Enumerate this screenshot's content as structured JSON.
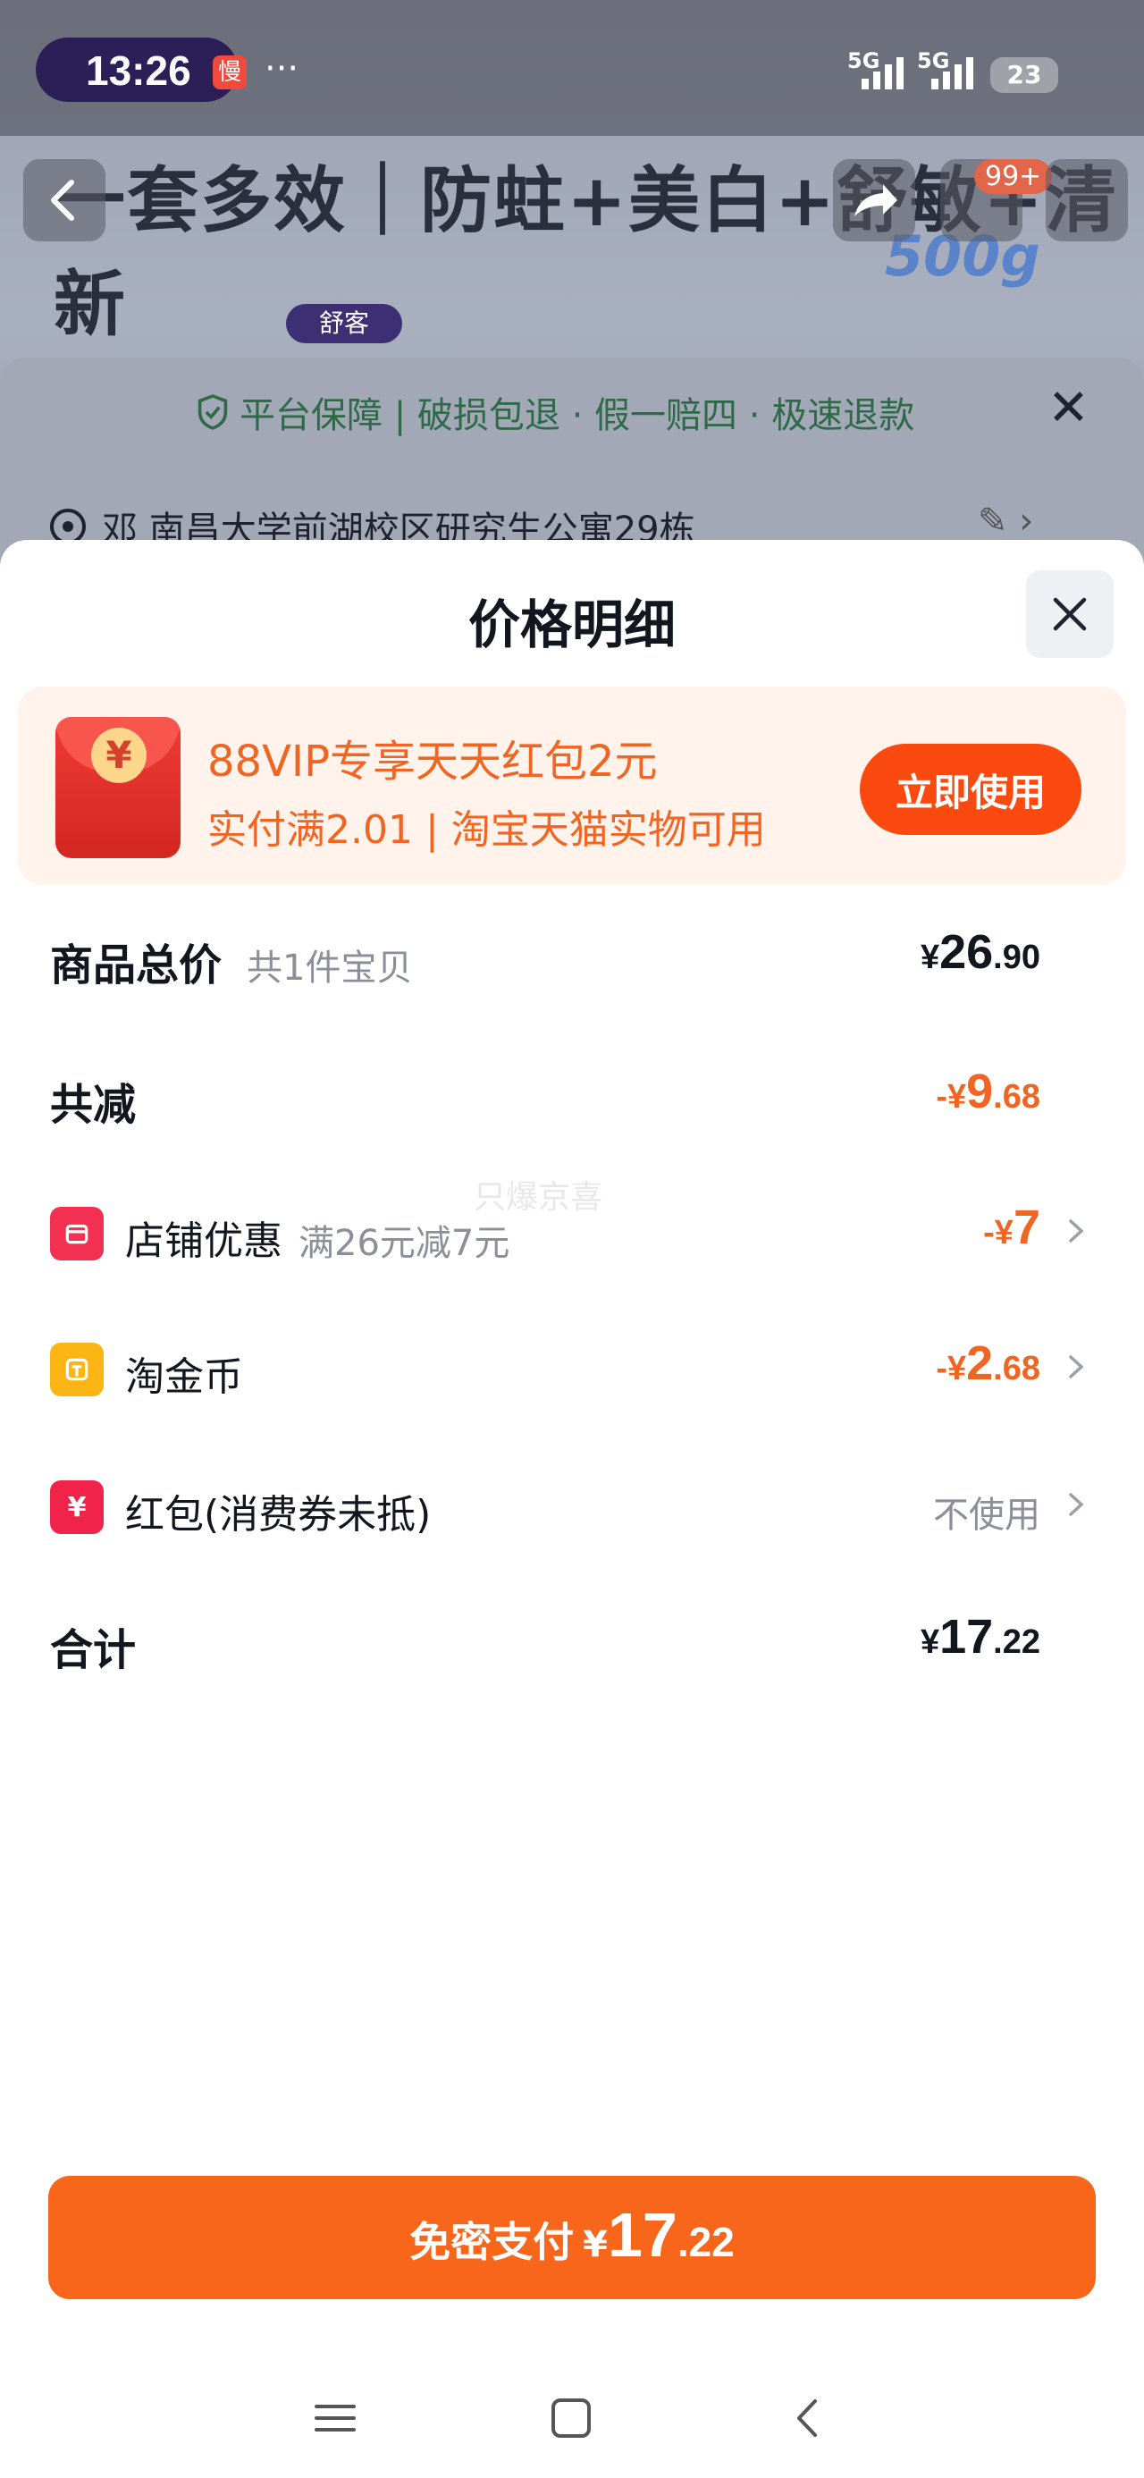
{
  "status_bar": {
    "time": "13:26",
    "slow_badge": "慢",
    "more": "···",
    "net1": "5G",
    "net2": "5G",
    "battery": "23"
  },
  "background": {
    "banner_text": "一套多效｜防蛀+美白+舒敏+清新",
    "weight_text": "500g",
    "cart_badge": "99+",
    "brand_logo": "舒客"
  },
  "guarantee": {
    "text": "平台保障 | 破损包退 · 假一赔四 · 极速退款"
  },
  "address": {
    "text": "邓 南昌大学前湖校区研究生公寓29栋"
  },
  "sheet": {
    "title": "价格明细"
  },
  "promo": {
    "coin": "¥",
    "title": "88VIP专享天天红包2元",
    "subtitle": "实付满2.01 | 淘宝天猫实物可用",
    "button": "立即使用"
  },
  "rows": {
    "total": {
      "label": "商品总价",
      "sub": "共1件宝贝",
      "yen": "¥",
      "int": "26",
      "dec": ".90"
    },
    "discount": {
      "label": "共减",
      "prefix": "-¥",
      "int": "9",
      "dec": ".68"
    },
    "store": {
      "label": "店铺优惠",
      "sub": "满26元减7元",
      "prefix": "-¥",
      "int": "7",
      "dec": ""
    },
    "coins": {
      "label": "淘金币",
      "prefix": "-¥",
      "int": "2",
      "dec": ".68"
    },
    "redpacket": {
      "label": "红包(消费券未抵)",
      "value": "不使用"
    },
    "sum": {
      "label": "合计",
      "yen": "¥",
      "int": "17",
      "dec": ".22"
    }
  },
  "watermark": "只爆京喜",
  "pay": {
    "label": "免密支付",
    "yen": "¥",
    "int": "17",
    "dec": ".22"
  },
  "colors": {
    "accent": "#f7661a",
    "promo_button": "#fa4a10",
    "discount_text": "#f06522"
  }
}
